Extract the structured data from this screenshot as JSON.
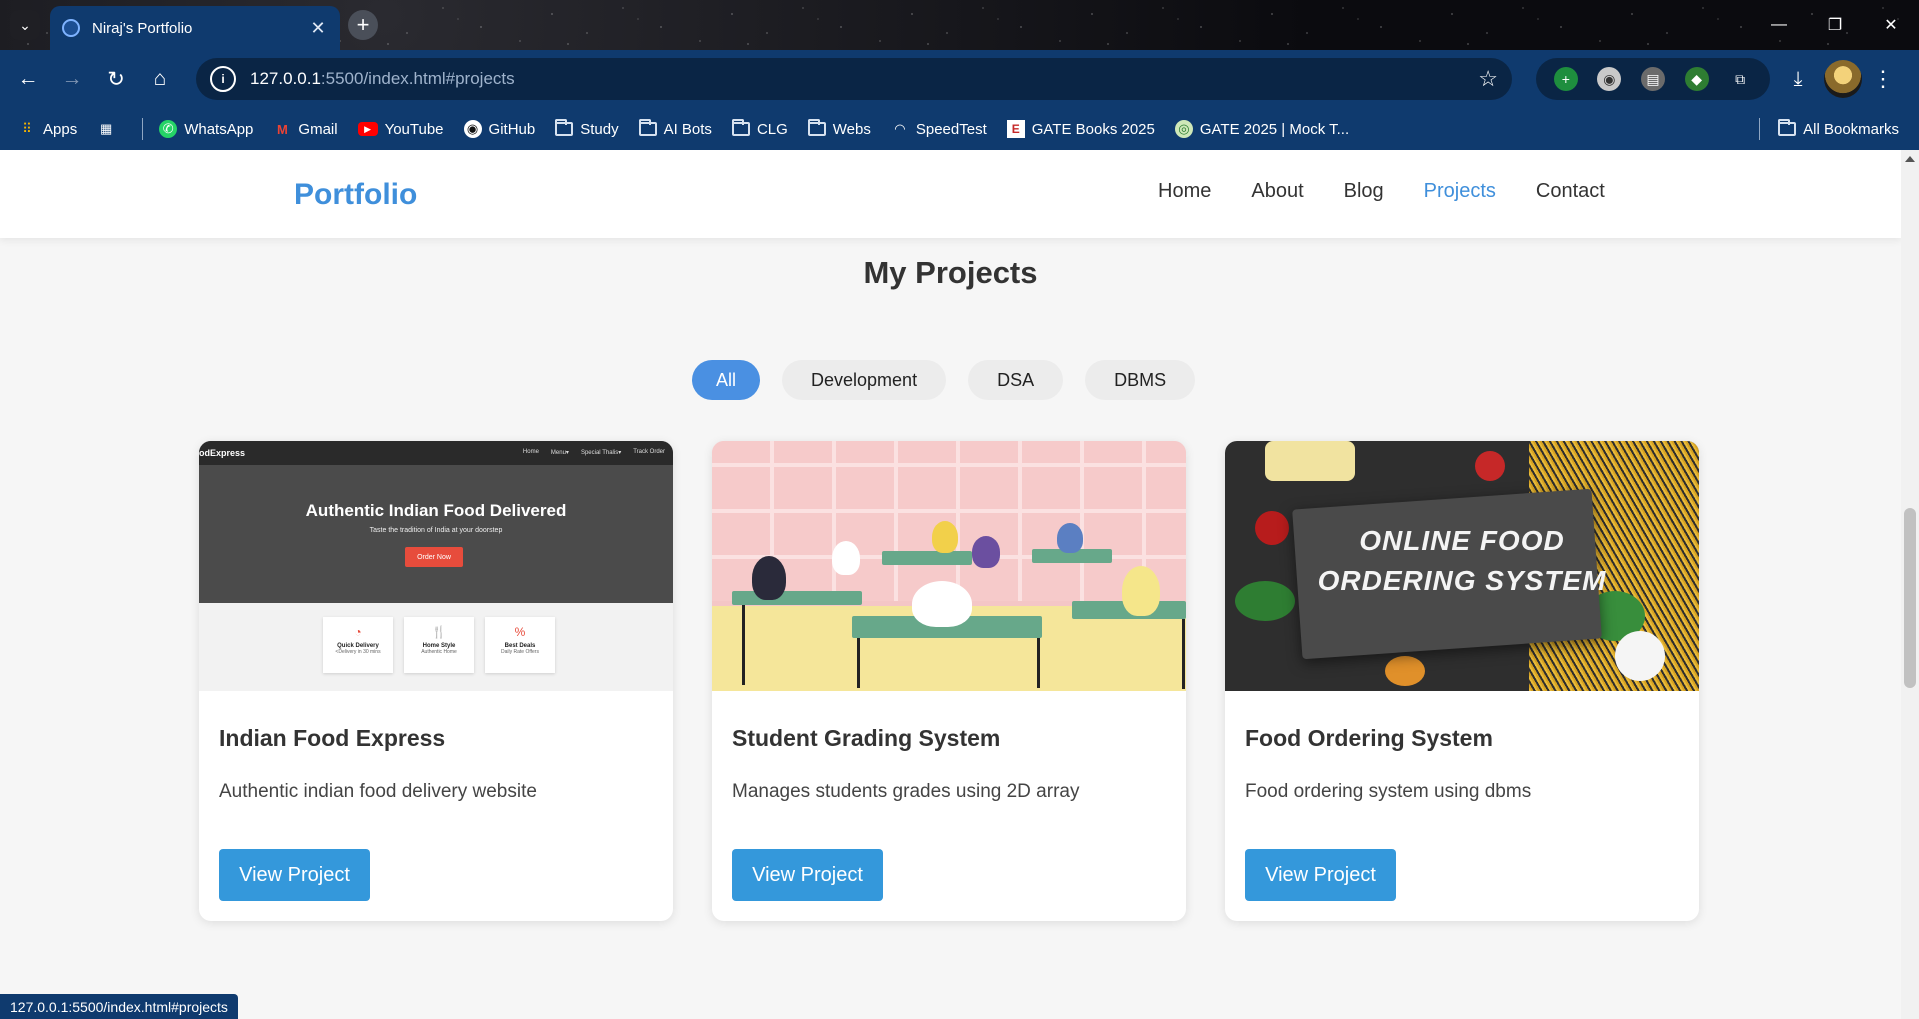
{
  "browser": {
    "tab_title": "Niraj's Portfolio",
    "tab_close": "✕",
    "new_tab": "+",
    "url_host": "127.0.0.1",
    "url_path": ":5500/index.html#projects",
    "site_info_icon": "i",
    "window": {
      "minimize": "—",
      "restore": "❐",
      "close": "✕"
    },
    "status_url": "127.0.0.1:5500/index.html#projects"
  },
  "bookmarks": {
    "apps": "Apps",
    "items": [
      {
        "label": "WhatsApp",
        "icon": "whatsapp-icon"
      },
      {
        "label": "Gmail",
        "icon": "gmail-icon"
      },
      {
        "label": "YouTube",
        "icon": "youtube-icon"
      },
      {
        "label": "GitHub",
        "icon": "github-icon"
      },
      {
        "label": "Study",
        "icon": "folder-icon"
      },
      {
        "label": "AI Bots",
        "icon": "folder-icon"
      },
      {
        "label": "CLG",
        "icon": "folder-icon"
      },
      {
        "label": "Webs",
        "icon": "folder-icon"
      },
      {
        "label": "SpeedTest",
        "icon": "speedtest-icon"
      },
      {
        "label": "GATE Books 2025",
        "icon": "gate-books-icon"
      },
      {
        "label": "GATE 2025 | Mock T...",
        "icon": "gate-mock-icon"
      }
    ],
    "all_bookmarks": "All Bookmarks"
  },
  "site": {
    "brand": "Portfolio",
    "nav": [
      "Home",
      "About",
      "Blog",
      "Projects",
      "Contact"
    ],
    "active_nav": "Projects",
    "section_title": "My Projects",
    "filters": [
      "All",
      "Development",
      "DSA",
      "DBMS"
    ],
    "active_filter": "All",
    "projects": [
      {
        "title": "Indian Food Express",
        "description": "Authentic indian food delivery website",
        "button": "View Project"
      },
      {
        "title": "Student Grading System",
        "description": "Manages students grades using 2D array",
        "button": "View Project"
      },
      {
        "title": "Food Ordering System",
        "description": "Food ordering system using dbms",
        "button": "View Project"
      }
    ]
  },
  "thumb1": {
    "brand": "odExpress",
    "menu": [
      "Home",
      "Menu▾",
      "Special Thalis▾",
      "Track Order"
    ],
    "hero": "Authentic Indian Food Delivered",
    "sub": "Taste the tradition of India at your doorstep",
    "cta": "Order Now",
    "features": [
      {
        "icon": "◔",
        "title": "Quick Delivery",
        "sub": "<Delivery in 30 mins"
      },
      {
        "icon": "🍴",
        "title": "Home Style",
        "sub": "Authentic Home"
      },
      {
        "icon": "%",
        "title": "Best Deals",
        "sub": "Daily Rate Offers"
      }
    ]
  },
  "thumb3": {
    "line1": "ONLINE FOOD",
    "line2": "ORDERING SYSTEM"
  },
  "colors": {
    "accent": "#3f8fdb",
    "button": "#3498db",
    "chrome": "#0f3a6e"
  }
}
